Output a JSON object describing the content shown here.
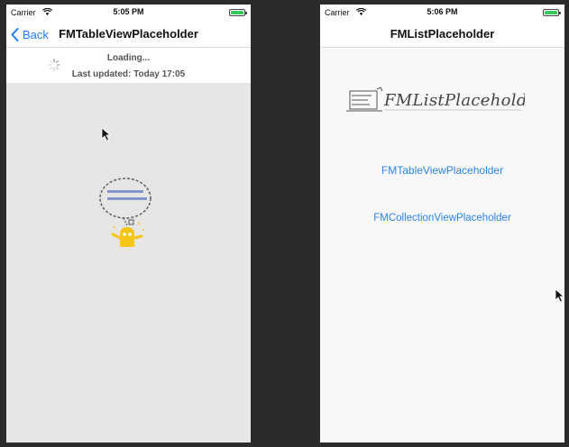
{
  "left_screen": {
    "status": {
      "carrier": "Carrier",
      "time": "5:05 PM"
    },
    "nav": {
      "back_label": "Back",
      "title": "FMTableViewPlaceholder"
    },
    "refresh": {
      "loading": "Loading...",
      "last_updated": "Last updated: Today 17:05"
    }
  },
  "right_screen": {
    "status": {
      "carrier": "Carrier",
      "time": "5:06 PM"
    },
    "nav": {
      "title": "FMListPlaceholder"
    },
    "links": [
      "FMTableViewPlaceholder",
      "FMCollectionViewPlaceholder"
    ]
  },
  "colors": {
    "accent": "#1d7cf2",
    "battery": "#34c759",
    "placeholder_bg": "#e8e6e5",
    "mascot": "#f5c518"
  }
}
